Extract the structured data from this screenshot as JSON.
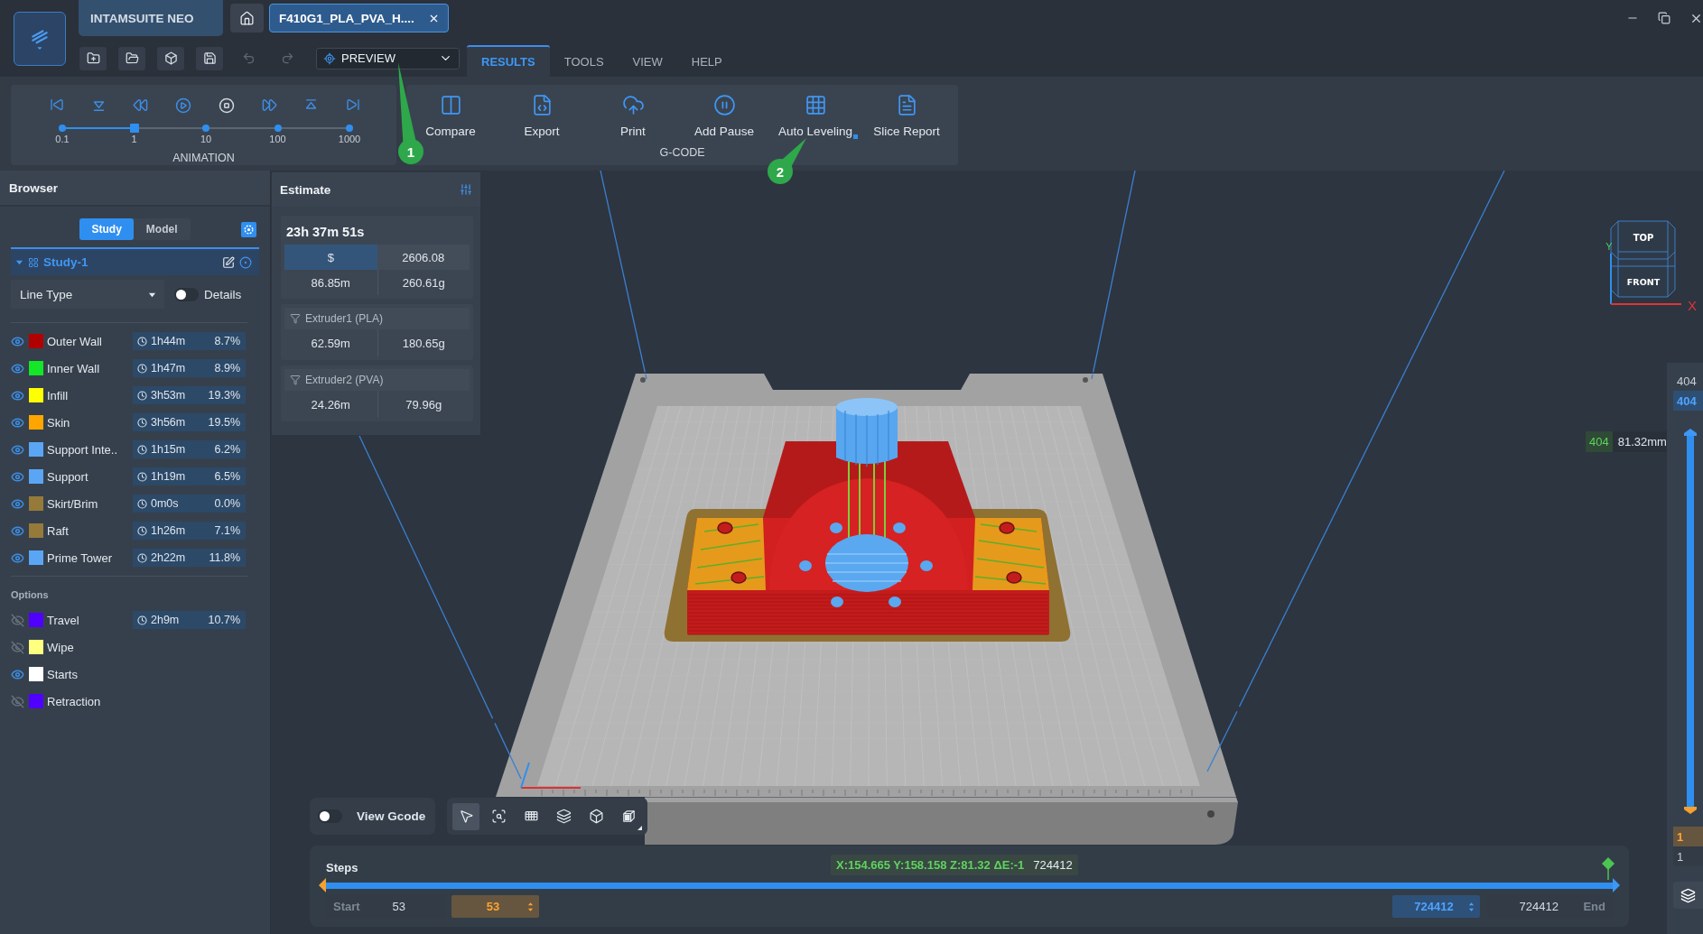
{
  "window": {
    "app_tab": "INTAMSUITE NEO",
    "file_tab": {
      "title": "F410G1_PLA_PVA_H....",
      "selected": true
    }
  },
  "toolbar": {
    "undo": {
      "disabled": true
    },
    "redo": {
      "disabled": true
    },
    "mode": "PREVIEW"
  },
  "menu_tabs": [
    {
      "label": "RESULTS",
      "selected": true
    },
    {
      "label": "TOOLS",
      "selected": false
    },
    {
      "label": "VIEW",
      "selected": false
    },
    {
      "label": "HELP",
      "selected": false
    }
  ],
  "animation": {
    "title": "ANIMATION",
    "speeds": [
      "0.1",
      "1",
      "10",
      "100",
      "1000"
    ],
    "level": 0.25
  },
  "gcode": {
    "title": "G-CODE",
    "buttons": [
      {
        "kind": "compare",
        "label": "Compare",
        "dropdown": false
      },
      {
        "kind": "export",
        "label": "Export",
        "dropdown": false
      },
      {
        "kind": "print",
        "label": "Print",
        "dropdown": false
      },
      {
        "kind": "pause",
        "label": "Add Pause",
        "dropdown": false
      },
      {
        "kind": "leveling",
        "label": "Auto Leveling",
        "dropdown": true
      },
      {
        "kind": "report",
        "label": "Slice Report",
        "dropdown": false
      }
    ]
  },
  "annotations": [
    {
      "label": "1"
    },
    {
      "label": "2"
    }
  ],
  "browser": {
    "title": "Browser",
    "tabs": [
      {
        "label": "Study",
        "selected": true
      },
      {
        "label": "Model",
        "selected": false
      }
    ],
    "study": {
      "name": "Study-1",
      "expanded": true
    },
    "line_type": {
      "value": "Line Type"
    },
    "details": {
      "label": "Details",
      "on": false
    },
    "line_types": [
      {
        "name": "Outer Wall",
        "color": "#b00000",
        "visible": true,
        "time": "1h44m",
        "share": "8.7%"
      },
      {
        "name": "Inner Wall",
        "color": "#14e628",
        "visible": true,
        "time": "1h47m",
        "share": "8.9%"
      },
      {
        "name": "Infill",
        "color": "#ffff00",
        "visible": true,
        "time": "3h53m",
        "share": "19.3%"
      },
      {
        "name": "Skin",
        "color": "#ffa500",
        "visible": true,
        "time": "3h56m",
        "share": "19.5%"
      },
      {
        "name": "Support Inte..",
        "color": "#5aa6f5",
        "visible": true,
        "time": "1h15m",
        "share": "6.2%"
      },
      {
        "name": "Support",
        "color": "#5aa6f5",
        "visible": true,
        "time": "1h19m",
        "share": "6.5%"
      },
      {
        "name": "Skirt/Brim",
        "color": "#957a3a",
        "visible": true,
        "time": "0m0s",
        "share": "0.0%"
      },
      {
        "name": "Raft",
        "color": "#957a3a",
        "visible": true,
        "time": "1h26m",
        "share": "7.1%"
      },
      {
        "name": "Prime Tower",
        "color": "#5aa6f5",
        "visible": true,
        "time": "2h22m",
        "share": "11.8%"
      }
    ],
    "options_title": "Options",
    "options": [
      {
        "name": "Travel",
        "color": "#5000ff",
        "visible": false,
        "time": "2h9m",
        "share": "10.7%"
      },
      {
        "name": "Wipe",
        "color": "#ffff80",
        "visible": false
      },
      {
        "name": "Starts",
        "color": "#ffffff",
        "visible": true
      },
      {
        "name": "Retraction",
        "color": "#5000ff",
        "visible": false
      }
    ]
  },
  "estimate": {
    "title": "Estimate",
    "total_time": "23h 37m 51s",
    "currency": "$",
    "cost": "2606.08",
    "length": "86.85m",
    "weight": "260.61g",
    "extruders": [
      {
        "name": "Extruder1 (PLA)",
        "length": "62.59m",
        "weight": "180.65g"
      },
      {
        "name": "Extruder2 (PVA)",
        "length": "24.26m",
        "weight": "79.96g"
      }
    ]
  },
  "view_cube": {
    "top": "TOP",
    "front": "FRONT",
    "x_axis": "X",
    "y_axis": "Y"
  },
  "layer_slider": {
    "top_max": "404",
    "top_value": "404",
    "thumb_layer": "404",
    "thumb_height": "81.32mm",
    "level": 1,
    "bottom_value": "1",
    "bottom_min": "1"
  },
  "viewer_toolbar": {
    "view_gcode": {
      "label": "View Gcode",
      "on": false
    },
    "tools": [
      {
        "kind": "select",
        "selected": true,
        "dropdown": false
      },
      {
        "kind": "zoom",
        "selected": false,
        "dropdown": false
      },
      {
        "kind": "plate",
        "selected": false,
        "dropdown": false
      },
      {
        "kind": "layers",
        "selected": false,
        "dropdown": false
      },
      {
        "kind": "cube",
        "selected": false,
        "dropdown": false
      },
      {
        "kind": "front",
        "selected": false,
        "dropdown": true
      }
    ]
  },
  "steps": {
    "title": "Steps",
    "level": 1,
    "position": "X:154.665 Y:158.158 Z:81.32 ΔE:-1",
    "position_step": "724412",
    "start_label": "Start",
    "start_min": "53",
    "start_value": "53",
    "end_value": "724412",
    "end_max": "724412",
    "end_label": "End"
  }
}
